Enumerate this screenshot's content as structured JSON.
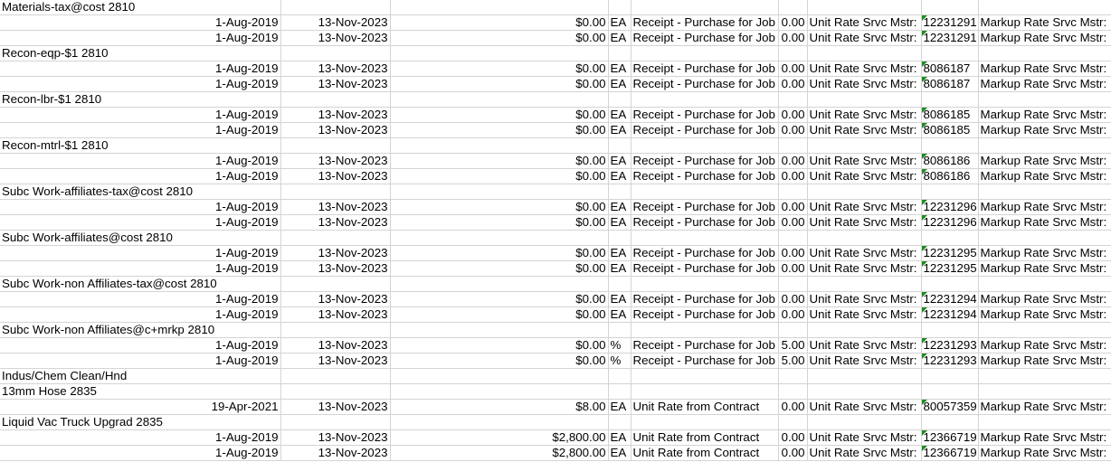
{
  "sheet": {
    "rows": [
      {
        "type": "category",
        "label": "Materials-tax@cost 2810"
      },
      {
        "type": "item",
        "start": "1-Aug-2019",
        "end": "13-Nov-2023",
        "price": "$0.00",
        "uom": "EA",
        "source": "Receipt - Purchase for Job",
        "markup": "0.00",
        "rate_label": "Unit Rate Srvc Mstr:",
        "id": "12231291",
        "markup_label": "Markup Rate Srvc Mstr:"
      },
      {
        "type": "item",
        "start": "1-Aug-2019",
        "end": "13-Nov-2023",
        "price": "$0.00",
        "uom": "EA",
        "source": "Receipt - Purchase for Job",
        "markup": "0.00",
        "rate_label": "Unit Rate Srvc Mstr:",
        "id": "12231291",
        "markup_label": "Markup Rate Srvc Mstr:"
      },
      {
        "type": "category",
        "label": "Recon-eqp-$1 2810"
      },
      {
        "type": "item",
        "start": "1-Aug-2019",
        "end": "13-Nov-2023",
        "price": "$0.00",
        "uom": "EA",
        "source": "Receipt - Purchase for Job",
        "markup": "0.00",
        "rate_label": "Unit Rate Srvc Mstr:",
        "id": "8086187",
        "markup_label": "Markup Rate Srvc Mstr:"
      },
      {
        "type": "item",
        "start": "1-Aug-2019",
        "end": "13-Nov-2023",
        "price": "$0.00",
        "uom": "EA",
        "source": "Receipt - Purchase for Job",
        "markup": "0.00",
        "rate_label": "Unit Rate Srvc Mstr:",
        "id": "8086187",
        "markup_label": "Markup Rate Srvc Mstr:"
      },
      {
        "type": "category",
        "label": "Recon-lbr-$1 2810"
      },
      {
        "type": "item",
        "start": "1-Aug-2019",
        "end": "13-Nov-2023",
        "price": "$0.00",
        "uom": "EA",
        "source": "Receipt - Purchase for Job",
        "markup": "0.00",
        "rate_label": "Unit Rate Srvc Mstr:",
        "id": "8086185",
        "markup_label": "Markup Rate Srvc Mstr:"
      },
      {
        "type": "item",
        "start": "1-Aug-2019",
        "end": "13-Nov-2023",
        "price": "$0.00",
        "uom": "EA",
        "source": "Receipt - Purchase for Job",
        "markup": "0.00",
        "rate_label": "Unit Rate Srvc Mstr:",
        "id": "8086185",
        "markup_label": "Markup Rate Srvc Mstr:"
      },
      {
        "type": "category",
        "label": "Recon-mtrl-$1 2810"
      },
      {
        "type": "item",
        "start": "1-Aug-2019",
        "end": "13-Nov-2023",
        "price": "$0.00",
        "uom": "EA",
        "source": "Receipt - Purchase for Job",
        "markup": "0.00",
        "rate_label": "Unit Rate Srvc Mstr:",
        "id": "8086186",
        "markup_label": "Markup Rate Srvc Mstr:"
      },
      {
        "type": "item",
        "start": "1-Aug-2019",
        "end": "13-Nov-2023",
        "price": "$0.00",
        "uom": "EA",
        "source": "Receipt - Purchase for Job",
        "markup": "0.00",
        "rate_label": "Unit Rate Srvc Mstr:",
        "id": "8086186",
        "markup_label": "Markup Rate Srvc Mstr:"
      },
      {
        "type": "category",
        "label": "Subc Work-affiliates-tax@cost 2810"
      },
      {
        "type": "item",
        "start": "1-Aug-2019",
        "end": "13-Nov-2023",
        "price": "$0.00",
        "uom": "EA",
        "source": "Receipt - Purchase for Job",
        "markup": "0.00",
        "rate_label": "Unit Rate Srvc Mstr:",
        "id": "12231296",
        "markup_label": "Markup Rate Srvc Mstr:"
      },
      {
        "type": "item",
        "start": "1-Aug-2019",
        "end": "13-Nov-2023",
        "price": "$0.00",
        "uom": "EA",
        "source": "Receipt - Purchase for Job",
        "markup": "0.00",
        "rate_label": "Unit Rate Srvc Mstr:",
        "id": "12231296",
        "markup_label": "Markup Rate Srvc Mstr:"
      },
      {
        "type": "category",
        "label": "Subc Work-affiliates@cost 2810"
      },
      {
        "type": "item",
        "start": "1-Aug-2019",
        "end": "13-Nov-2023",
        "price": "$0.00",
        "uom": "EA",
        "source": "Receipt - Purchase for Job",
        "markup": "0.00",
        "rate_label": "Unit Rate Srvc Mstr:",
        "id": "12231295",
        "markup_label": "Markup Rate Srvc Mstr:"
      },
      {
        "type": "item",
        "start": "1-Aug-2019",
        "end": "13-Nov-2023",
        "price": "$0.00",
        "uom": "EA",
        "source": "Receipt - Purchase for Job",
        "markup": "0.00",
        "rate_label": "Unit Rate Srvc Mstr:",
        "id": "12231295",
        "markup_label": "Markup Rate Srvc Mstr:"
      },
      {
        "type": "category",
        "label": "Subc Work-non Affiliates-tax@cost 2810"
      },
      {
        "type": "item",
        "start": "1-Aug-2019",
        "end": "13-Nov-2023",
        "price": "$0.00",
        "uom": "EA",
        "source": "Receipt - Purchase for Job",
        "markup": "0.00",
        "rate_label": "Unit Rate Srvc Mstr:",
        "id": "12231294",
        "markup_label": "Markup Rate Srvc Mstr:"
      },
      {
        "type": "item",
        "start": "1-Aug-2019",
        "end": "13-Nov-2023",
        "price": "$0.00",
        "uom": "EA",
        "source": "Receipt - Purchase for Job",
        "markup": "0.00",
        "rate_label": "Unit Rate Srvc Mstr:",
        "id": "12231294",
        "markup_label": "Markup Rate Srvc Mstr:"
      },
      {
        "type": "category",
        "label": "Subc Work-non Affiliates@c+mrkp 2810"
      },
      {
        "type": "item",
        "start": "1-Aug-2019",
        "end": "13-Nov-2023",
        "price": "$0.00",
        "uom": "%",
        "source": "Receipt - Purchase for Job",
        "markup": "5.00",
        "rate_label": "Unit Rate Srvc Mstr:",
        "id": "12231293",
        "markup_label": "Markup Rate Srvc Mstr:"
      },
      {
        "type": "item",
        "start": "1-Aug-2019",
        "end": "13-Nov-2023",
        "price": "$0.00",
        "uom": "%",
        "source": "Receipt - Purchase for Job",
        "markup": "5.00",
        "rate_label": "Unit Rate Srvc Mstr:",
        "id": "12231293",
        "markup_label": "Markup Rate Srvc Mstr:"
      },
      {
        "type": "category",
        "label": "Indus/Chem Clean/Hnd"
      },
      {
        "type": "category",
        "label": "13mm Hose 2835"
      },
      {
        "type": "item",
        "start": "19-Apr-2021",
        "end": "13-Nov-2023",
        "price": "$8.00",
        "uom": "EA",
        "source": "Unit Rate from Contract",
        "markup": "0.00",
        "rate_label": "Unit Rate Srvc Mstr:",
        "id": "80057359",
        "markup_label": "Markup Rate Srvc Mstr:"
      },
      {
        "type": "category",
        "label": "Liquid Vac Truck Upgrad 2835"
      },
      {
        "type": "item",
        "start": "1-Aug-2019",
        "end": "13-Nov-2023",
        "price": "$2,800.00",
        "uom": "EA",
        "source": "Unit Rate from Contract",
        "markup": "0.00",
        "rate_label": "Unit Rate Srvc Mstr:",
        "id": "12366719",
        "markup_label": "Markup Rate Srvc Mstr:"
      },
      {
        "type": "item",
        "start": "1-Aug-2019",
        "end": "13-Nov-2023",
        "price": "$2,800.00",
        "uom": "EA",
        "source": "Unit Rate from Contract",
        "markup": "0.00",
        "rate_label": "Unit Rate Srvc Mstr:",
        "id": "12366719",
        "markup_label": "Markup Rate Srvc Mstr:"
      }
    ]
  },
  "colors": {
    "gridline": "#d4d4d4",
    "comment_indicator": "#1e8c1e",
    "text": "#000000"
  }
}
